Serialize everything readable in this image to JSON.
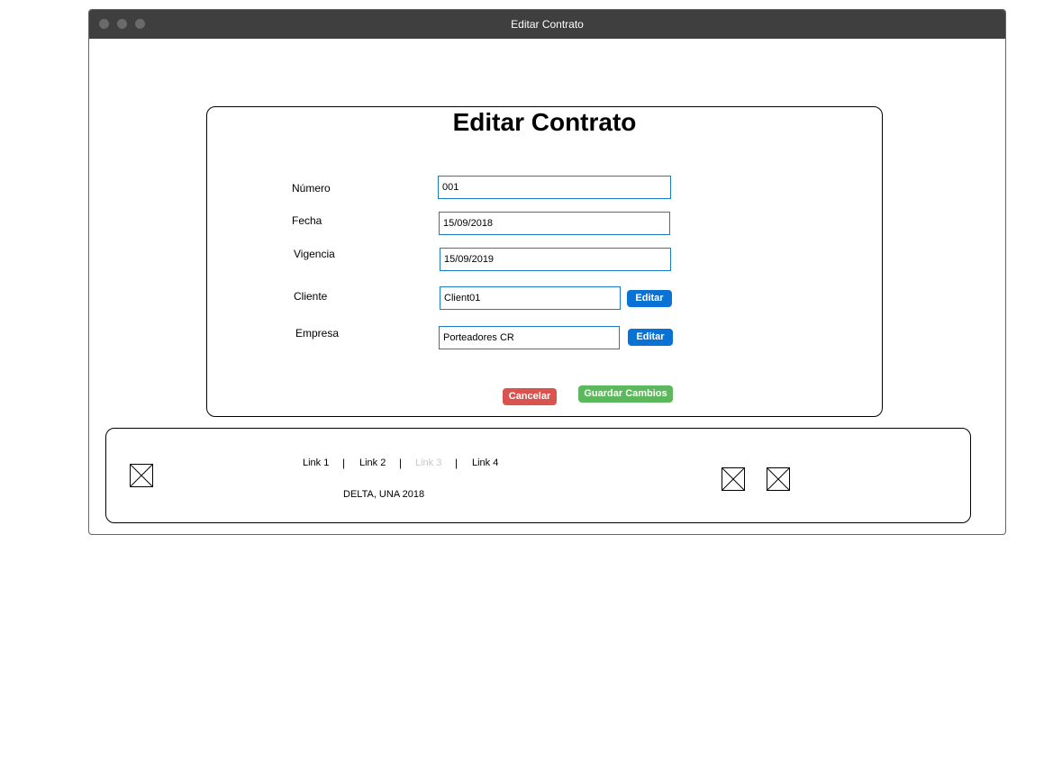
{
  "window": {
    "title": "Editar Contrato"
  },
  "form": {
    "title": "Editar Contrato",
    "fields": [
      {
        "label": "Número",
        "value": "001"
      },
      {
        "label": "Fecha",
        "value": "15/09/2018"
      },
      {
        "label": "Vigencia",
        "value": "15/09/2019"
      },
      {
        "label": "Cliente",
        "value": "Client01"
      },
      {
        "label": "Empresa",
        "value": "Porteadores CR"
      }
    ],
    "edit_button_label": "Editar",
    "cancel_label": "Cancelar",
    "save_label": "Guardar Cambios"
  },
  "footer": {
    "links": [
      "Link 1",
      "Link 2",
      "Link 3",
      "Link 4"
    ],
    "separator": "|",
    "copyright": "DELTA, UNA 2018",
    "disabled_link_color": "#c8c8c8"
  },
  "colors": {
    "titlebar": "#3f3f3f",
    "field_border": "#1a7bc4",
    "edit_button": "#0a72d4",
    "cancel_button": "#d9534f",
    "save_button": "#5cb85c"
  }
}
